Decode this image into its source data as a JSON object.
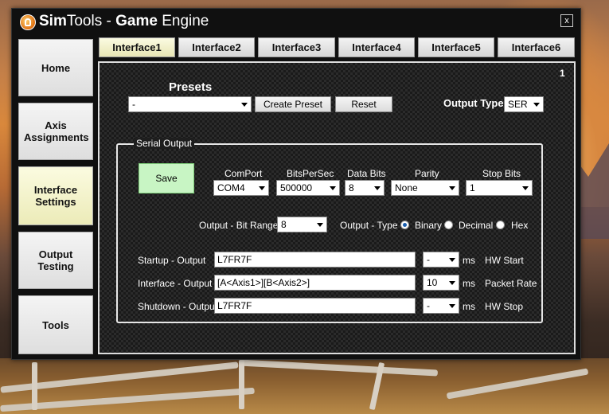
{
  "window": {
    "title_bold": "Sim",
    "title_mid": "Tools - ",
    "title_bold2": "Game",
    "title_end": " Engine",
    "close_label": "x"
  },
  "sidebar": {
    "items": [
      {
        "label": "Home"
      },
      {
        "label": "Axis Assignments"
      },
      {
        "label": "Interface Settings",
        "active": true
      },
      {
        "label": "Output Testing"
      },
      {
        "label": "Tools"
      }
    ]
  },
  "tabs": [
    {
      "label": "Interface1",
      "active": true
    },
    {
      "label": "Interface2"
    },
    {
      "label": "Interface3"
    },
    {
      "label": "Interface4"
    },
    {
      "label": "Interface5"
    },
    {
      "label": "Interface6"
    }
  ],
  "panel": {
    "page_number": "1",
    "presets": {
      "title": "Presets",
      "selected": "-",
      "create_label": "Create Preset",
      "reset_label": "Reset"
    },
    "output_type": {
      "label": "Output Type",
      "selected": "SER"
    },
    "serial": {
      "group_title": "Serial Output",
      "save_label": "Save",
      "comport": {
        "label": "ComPort",
        "selected": "COM4"
      },
      "bitspersec": {
        "label": "BitsPerSec",
        "selected": "500000"
      },
      "databits": {
        "label": "Data Bits",
        "selected": "8"
      },
      "parity": {
        "label": "Parity",
        "selected": "None"
      },
      "stopbits": {
        "label": "Stop Bits",
        "selected": "1"
      },
      "bitrange": {
        "label": "Output - Bit Range",
        "selected": "8"
      },
      "outtype": {
        "label": "Output - Type",
        "options": [
          "Binary",
          "Decimal",
          "Hex"
        ],
        "selected": "Binary"
      },
      "startup": {
        "label": "Startup - Output",
        "value": "L7FR7F",
        "combo": "-",
        "unit": "ms",
        "suffix": "HW Start"
      },
      "interface": {
        "label": "Interface - Output",
        "value": "[A<Axis1>][B<Axis2>]",
        "combo": "10",
        "unit": "ms",
        "suffix": "Packet Rate"
      },
      "shutdown": {
        "label": "Shutdown - Output",
        "value": "L7FR7F",
        "combo": "-",
        "unit": "ms",
        "suffix": "HW Stop"
      }
    }
  }
}
